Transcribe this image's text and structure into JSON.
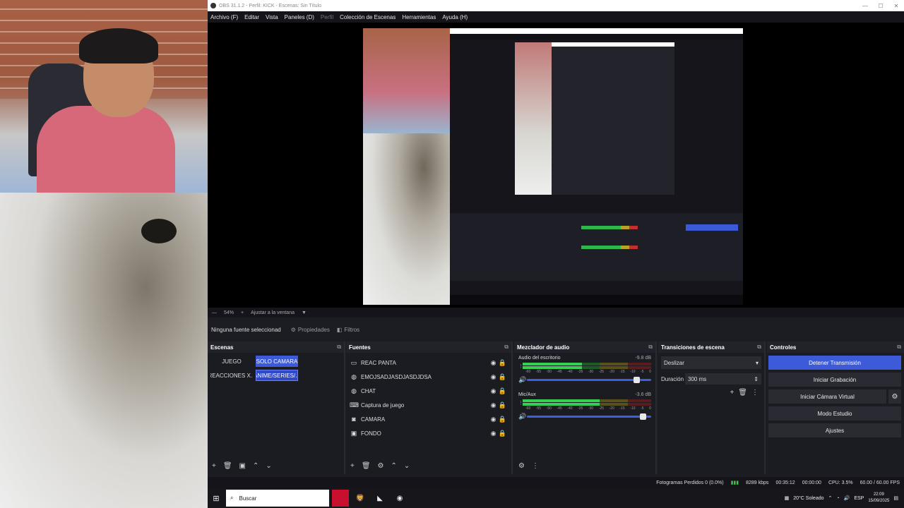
{
  "window": {
    "title": "OBS 31.1.2 - Perfil: KICK - Escenas: Sin Título",
    "minimize": "—",
    "maximize": "☐",
    "close": "✕"
  },
  "menu": {
    "items": [
      "Archivo (F)",
      "Editar",
      "Vista",
      "Paneles (D)",
      "Perfil",
      "Colección de Escenas",
      "Herramientas",
      "Ayuda (H)"
    ]
  },
  "preview_bar": {
    "zoom": "54%",
    "fit": "Ajustar a la ventana"
  },
  "source_bar": {
    "no_selection": "Ninguna fuente seleccionad",
    "properties": "Propiedades",
    "filters": "Filtros"
  },
  "scenes": {
    "title": "Escenas",
    "items": [
      {
        "label": "JUEGO",
        "state": "normal"
      },
      {
        "label": "SOLO CAMARA",
        "state": "active"
      },
      {
        "label": "REACCIONES X...",
        "state": "normal"
      },
      {
        "label": "ANIME/SERIES/...",
        "state": "selected"
      }
    ]
  },
  "sources": {
    "title": "Fuentes",
    "items": [
      {
        "label": "REAC PANTA",
        "icon": "monitor-icon"
      },
      {
        "label": "EMOJSADJASDJASDJDSA",
        "icon": "globe-icon"
      },
      {
        "label": "CHAT",
        "icon": "globe-icon"
      },
      {
        "label": "Captura de juego",
        "icon": "gamepad-icon"
      },
      {
        "label": "CAMARA",
        "icon": "camera-icon"
      },
      {
        "label": "FONDO",
        "icon": "image-icon"
      }
    ]
  },
  "mixer": {
    "title": "Mezclador de audio",
    "channels": [
      {
        "name": "Audio del escritorio",
        "db": "-9.8 dB",
        "level": 0.46,
        "fader": 0.88
      },
      {
        "name": "Mic/Aux",
        "db": "-3.6 dB",
        "level": 0.6,
        "fader": 0.93
      }
    ],
    "scale": [
      "-60",
      "-55",
      "-50",
      "-45",
      "-40",
      "-35",
      "-30",
      "-25",
      "-20",
      "-15",
      "-10",
      "-5",
      "0"
    ]
  },
  "transitions": {
    "title": "Transiciones de escena",
    "selected": "Deslizar",
    "duration_label": "Duración",
    "duration_value": "300 ms"
  },
  "controls": {
    "title": "Controles",
    "stop_stream": "Detener Transmisión",
    "start_recording": "Iniciar Grabación",
    "start_virtual_cam": "Iniciar Cámara Virtual",
    "studio_mode": "Modo Estudio",
    "settings": "Ajustes"
  },
  "status": {
    "dropped_frames": "Fotogramas Perdidos 0 (0.0%)",
    "bitrate": "8289 kbps",
    "stream_time": "00:35:12",
    "rec_time": "00:00:00",
    "cpu": "CPU: 3.5%",
    "fps": "60.00 / 60.00 FPS"
  },
  "taskbar": {
    "search": "Buscar",
    "weather": "20°C Soleado",
    "lang": "ESP",
    "time": "22:09",
    "date": "15/09/2025"
  },
  "colors": {
    "accent": "#3d5ad8",
    "panel": "#1b1b22",
    "meter_green": "#35d052"
  }
}
